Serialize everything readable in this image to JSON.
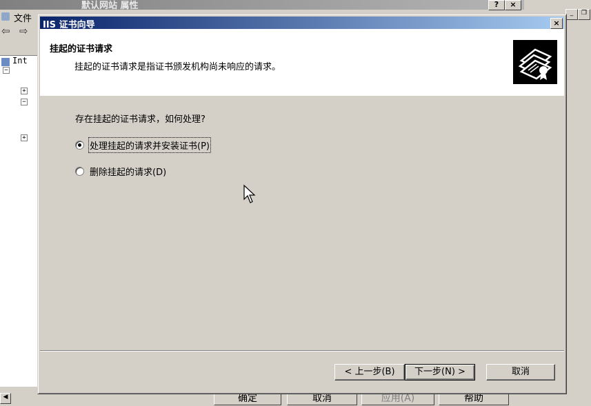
{
  "background": {
    "props_window_title": "默认网站 属性",
    "mmc_menu_first": "文件",
    "tree_root_label": "Int",
    "bottom_buttons": [
      "确定",
      "取消",
      "应用(A)",
      "帮助"
    ]
  },
  "dialog": {
    "title": "IIS 证书向导",
    "close_label": "×",
    "header_title": "挂起的证书请求",
    "header_desc": "挂起的证书请求是指证书颁发机构尚未响应的请求。",
    "icon": "certificate-icon",
    "question": "存在挂起的证书请求，如何处理?",
    "options": [
      {
        "label": "处理挂起的请求并安装证书(P)",
        "checked": true
      },
      {
        "label": "删除挂起的请求(D)",
        "checked": false
      }
    ],
    "buttons": {
      "back": "< 上一步(B)",
      "next": "下一步(N) >",
      "cancel": "取消"
    }
  },
  "colors": {
    "titlebar_start": "#0a246a",
    "titlebar_end": "#a6caf0",
    "face": "#d4d0c8"
  }
}
